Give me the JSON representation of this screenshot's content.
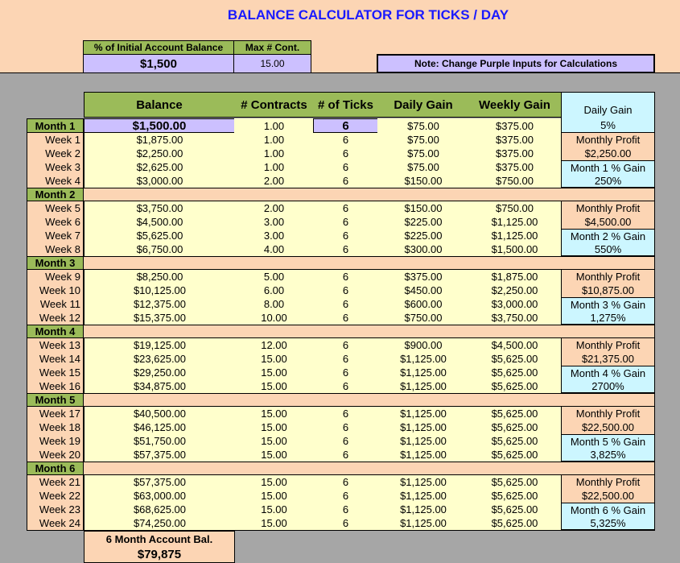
{
  "title": "BALANCE CALCULATOR FOR TICKS / DAY",
  "inputs": {
    "initial_label": "% of Initial Account Balance",
    "initial_value": "$1,500",
    "maxcont_label": "Max # Cont.",
    "maxcont_value": "15.00",
    "note": "Note: Change Purple Inputs for Calculations"
  },
  "headers": {
    "balance": "Balance",
    "contracts": "# Contracts",
    "ticks": "# of Ticks",
    "daily": "Daily Gain",
    "weekly": "Weekly Gain",
    "side": "Daily Gain"
  },
  "month1": {
    "label": "Month 1",
    "balance": "$1,500.00",
    "contracts": "1.00",
    "ticks": "6",
    "daily": "$75.00",
    "weekly": "$375.00",
    "side": "5%"
  },
  "months": [
    {
      "label": "Month 2",
      "profit_label": "Monthly Profit",
      "profit": "$2,250.00",
      "gain_label": "Month 1 % Gain",
      "gain": "250%",
      "weeks": [
        [
          "Week 1",
          "$1,875.00",
          "1.00",
          "6",
          "$75.00",
          "$375.00"
        ],
        [
          "Week 2",
          "$2,250.00",
          "1.00",
          "6",
          "$75.00",
          "$375.00"
        ],
        [
          "Week 3",
          "$2,625.00",
          "1.00",
          "6",
          "$75.00",
          "$375.00"
        ],
        [
          "Week 4",
          "$3,000.00",
          "2.00",
          "6",
          "$150.00",
          "$750.00"
        ]
      ]
    },
    {
      "label": "Month 3",
      "profit_label": "Monthly Profit",
      "profit": "$4,500.00",
      "gain_label": "Month 2 % Gain",
      "gain": "550%",
      "weeks": [
        [
          "Week 5",
          "$3,750.00",
          "2.00",
          "6",
          "$150.00",
          "$750.00"
        ],
        [
          "Week 6",
          "$4,500.00",
          "3.00",
          "6",
          "$225.00",
          "$1,125.00"
        ],
        [
          "Week 7",
          "$5,625.00",
          "3.00",
          "6",
          "$225.00",
          "$1,125.00"
        ],
        [
          "Week 8",
          "$6,750.00",
          "4.00",
          "6",
          "$300.00",
          "$1,500.00"
        ]
      ]
    },
    {
      "label": "Month 4",
      "profit_label": "Monthly Profit",
      "profit": "$10,875.00",
      "gain_label": "Month 3 % Gain",
      "gain": "1,275%",
      "weeks": [
        [
          "Week 9",
          "$8,250.00",
          "5.00",
          "6",
          "$375.00",
          "$1,875.00"
        ],
        [
          "Week 10",
          "$10,125.00",
          "6.00",
          "6",
          "$450.00",
          "$2,250.00"
        ],
        [
          "Week 11",
          "$12,375.00",
          "8.00",
          "6",
          "$600.00",
          "$3,000.00"
        ],
        [
          "Week 12",
          "$15,375.00",
          "10.00",
          "6",
          "$750.00",
          "$3,750.00"
        ]
      ]
    },
    {
      "label": "Month 5",
      "profit_label": "Monthly Profit",
      "profit": "$21,375.00",
      "gain_label": "Month 4 % Gain",
      "gain": "2700%",
      "weeks": [
        [
          "Week 13",
          "$19,125.00",
          "12.00",
          "6",
          "$900.00",
          "$4,500.00"
        ],
        [
          "Week 14",
          "$23,625.00",
          "15.00",
          "6",
          "$1,125.00",
          "$5,625.00"
        ],
        [
          "Week 15",
          "$29,250.00",
          "15.00",
          "6",
          "$1,125.00",
          "$5,625.00"
        ],
        [
          "Week 16",
          "$34,875.00",
          "15.00",
          "6",
          "$1,125.00",
          "$5,625.00"
        ]
      ]
    },
    {
      "label": "Month 6",
      "profit_label": "Monthly Profit",
      "profit": "$22,500.00",
      "gain_label": "Month 5 % Gain",
      "gain": "3,825%",
      "weeks": [
        [
          "Week 17",
          "$40,500.00",
          "15.00",
          "6",
          "$1,125.00",
          "$5,625.00"
        ],
        [
          "Week 18",
          "$46,125.00",
          "15.00",
          "6",
          "$1,125.00",
          "$5,625.00"
        ],
        [
          "Week 19",
          "$51,750.00",
          "15.00",
          "6",
          "$1,125.00",
          "$5,625.00"
        ],
        [
          "Week 20",
          "$57,375.00",
          "15.00",
          "6",
          "$1,125.00",
          "$5,625.00"
        ]
      ]
    },
    {
      "label": "",
      "profit_label": "Monthly Profit",
      "profit": "$22,500.00",
      "gain_label": "Month 6 % Gain",
      "gain": "5,325%",
      "weeks": [
        [
          "Week 21",
          "$57,375.00",
          "15.00",
          "6",
          "$1,125.00",
          "$5,625.00"
        ],
        [
          "Week 22",
          "$63,000.00",
          "15.00",
          "6",
          "$1,125.00",
          "$5,625.00"
        ],
        [
          "Week 23",
          "$68,625.00",
          "15.00",
          "6",
          "$1,125.00",
          "$5,625.00"
        ],
        [
          "Week 24",
          "$74,250.00",
          "15.00",
          "6",
          "$1,125.00",
          "$5,625.00"
        ]
      ]
    }
  ],
  "footer": {
    "label": "6 Month Account Bal.",
    "value": "$79,875"
  },
  "colors": {
    "peach": "#fcd5b4",
    "yellow": "#ffffcc",
    "cyan": "#ccf6ff",
    "green": "#9bbb59",
    "purple": "#ccc0ff",
    "gray": "#a6a6a6",
    "title_blue": "#1a1aff"
  }
}
